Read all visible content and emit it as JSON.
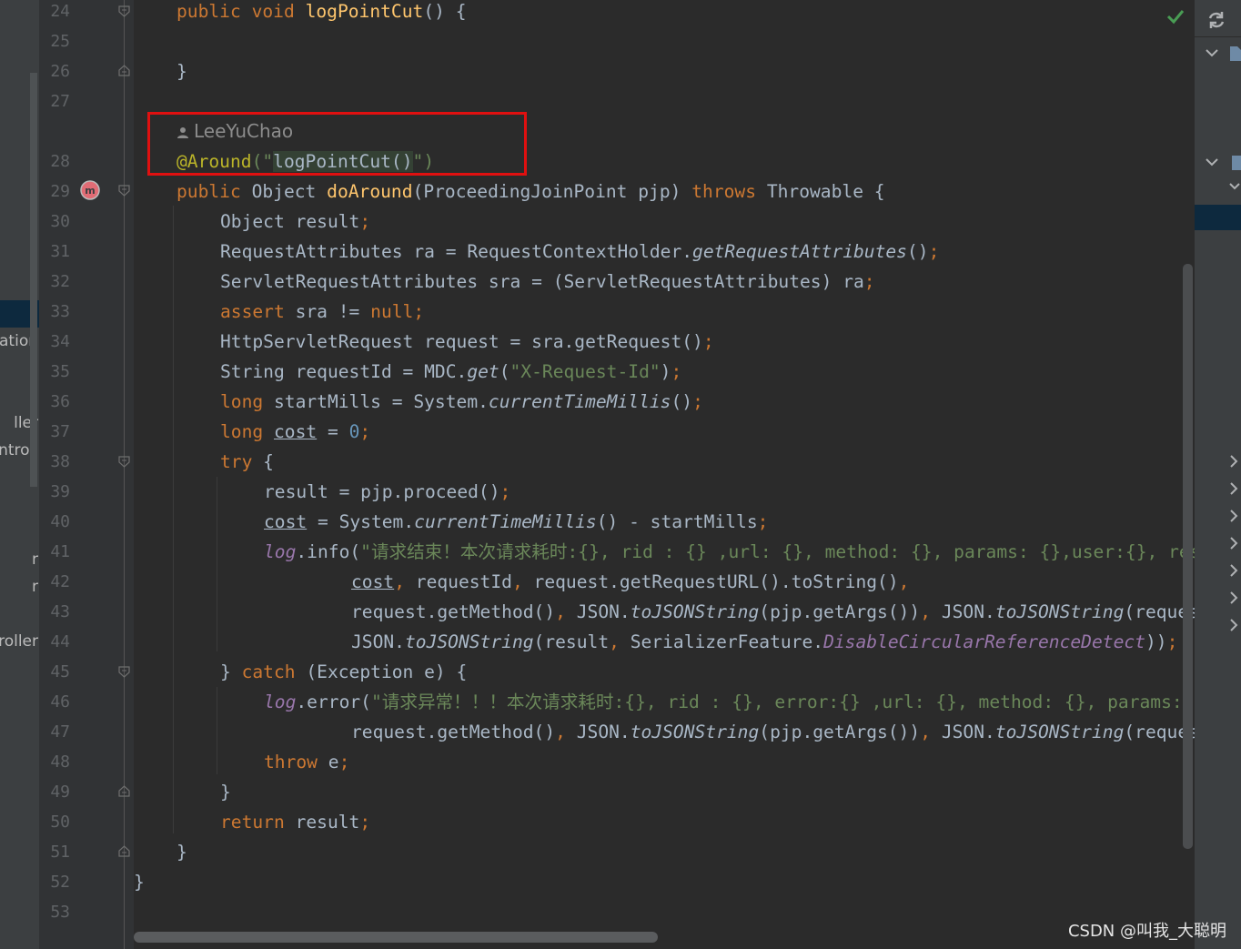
{
  "project_panel": {
    "fragments": [
      "ation",
      "ller",
      "ntroll",
      "r",
      "r",
      "roller"
    ]
  },
  "editor": {
    "line_numbers": [
      "24",
      "25",
      "26",
      "27",
      "28",
      "29",
      "30",
      "31",
      "32",
      "33",
      "34",
      "35",
      "36",
      "37",
      "38",
      "39",
      "40",
      "41",
      "42",
      "43",
      "44",
      "45",
      "46",
      "47",
      "48",
      "49",
      "50",
      "51",
      "52",
      "53"
    ],
    "author": "LeeYuChao",
    "code": {
      "l24_pub": "public void ",
      "l24_fn": "logPointCut",
      "l24_rest": "() {",
      "l26": "}",
      "l28_ann": "@Around",
      "l28_p1": "(\"",
      "l28_ref": "logPointCut()",
      "l28_p2": "\")",
      "l29_pub": "public ",
      "l29_type": "Object ",
      "l29_fn": "doAround",
      "l29_params": "(ProceedingJoinPoint pjp) ",
      "l29_throws": "throws",
      "l29_rest": " Throwable {",
      "l30_a": "Object result",
      "l30_semi": ";",
      "l31_a": "RequestAttributes ra = RequestContextHolder.",
      "l31_it": "getRequestAttributes",
      "l31_b": "()",
      "l31_semi": ";",
      "l32_a": "ServletRequestAttributes sra = (ServletRequestAttributes) ra",
      "l32_semi": ";",
      "l33_kw": "assert",
      "l33_a": " sra != ",
      "l33_null": "null",
      "l33_semi": ";",
      "l34_a": "HttpServletRequest request = sra.getRequest()",
      "l34_semi": ";",
      "l35_a": "String requestId = MDC.",
      "l35_it": "get",
      "l35_p1": "(",
      "l35_str": "\"X-Request-Id\"",
      "l35_p2": ")",
      "l35_semi": ";",
      "l36_kw": "long",
      "l36_a": " startMills = System.",
      "l36_it": "currentTimeMillis",
      "l36_b": "()",
      "l36_semi": ";",
      "l37_kw": "long",
      "l37_sp": " ",
      "l37_cost": "cost",
      "l37_eq": " = ",
      "l37_num": "0",
      "l37_semi": ";",
      "l38_kw": "try",
      "l38_a": " {",
      "l39_a": "result = pjp.proceed()",
      "l39_semi": ";",
      "l40_cost": "cost",
      "l40_a": " = System.",
      "l40_it": "currentTimeMillis",
      "l40_b": "() - startMills",
      "l40_semi": ";",
      "l41_log": "log",
      "l41_a": ".info(",
      "l41_str": "\"请求结束！本次请求耗时:{}, rid : {} ,url: {}, method: {}, params: {},user:{}, response: {}\"",
      "l41_comma": ",",
      "l42_cost": "cost",
      "l42_c1": ",",
      "l42_a": " requestId",
      "l42_c2": ",",
      "l42_b": " request.getRequestURL().toString()",
      "l42_c3": ",",
      "l43_a": "request.getMethod()",
      "l43_c1": ",",
      "l43_b": " JSON.",
      "l43_it1": "toJSONString",
      "l43_c": "(pjp.getArgs())",
      "l43_c2": ",",
      "l43_d": " JSON.",
      "l43_it2": "toJSONString",
      "l43_e": "(request.getUserPrincipal()),",
      "l44_a": "JSON.",
      "l44_it": "toJSONString",
      "l44_b": "(result",
      "l44_c1": ",",
      "l44_c": " SerializerFeature.",
      "l44_fld": "DisableCircularReferenceDetect",
      "l44_d": "))",
      "l44_semi": ";",
      "l45_a": "} ",
      "l45_kw": "catch",
      "l45_b": " (Exception e) {",
      "l46_log": "log",
      "l46_a": ".error(",
      "l46_str": "\"请求异常！！！本次请求耗时:{}, rid : {}, error:{} ,url: {}, method: {}, params: {}\"",
      "l47_a": "request.getMethod()",
      "l47_c1": ",",
      "l47_b": " JSON.",
      "l47_it1": "toJSONString",
      "l47_c": "(pjp.getArgs())",
      "l47_c2": ",",
      "l47_d": " JSON.",
      "l47_it2": "toJSONString",
      "l47_e": "(request.getUserPrincipal()));",
      "l48_kw": "throw",
      "l48_a": " e",
      "l48_semi": ";",
      "l49": "}",
      "l50_kw": "return",
      "l50_a": " result",
      "l50_semi": ";",
      "l51": "}",
      "l52": "}"
    }
  },
  "watermark": "CSDN @叫我_大聪明",
  "colors": {
    "keyword": "#cc7832",
    "method_decl": "#ffc66d",
    "string": "#6a8759",
    "number": "#6897bb",
    "annotation": "#bbb529",
    "field": "#9876aa",
    "default_text": "#a9b7c6",
    "highlight_box": "#e01010"
  },
  "icons": [
    "checkmark-icon",
    "refresh-icon",
    "collapse-icon",
    "expand-icon",
    "maven-icon",
    "user-icon",
    "fold-icon"
  ]
}
